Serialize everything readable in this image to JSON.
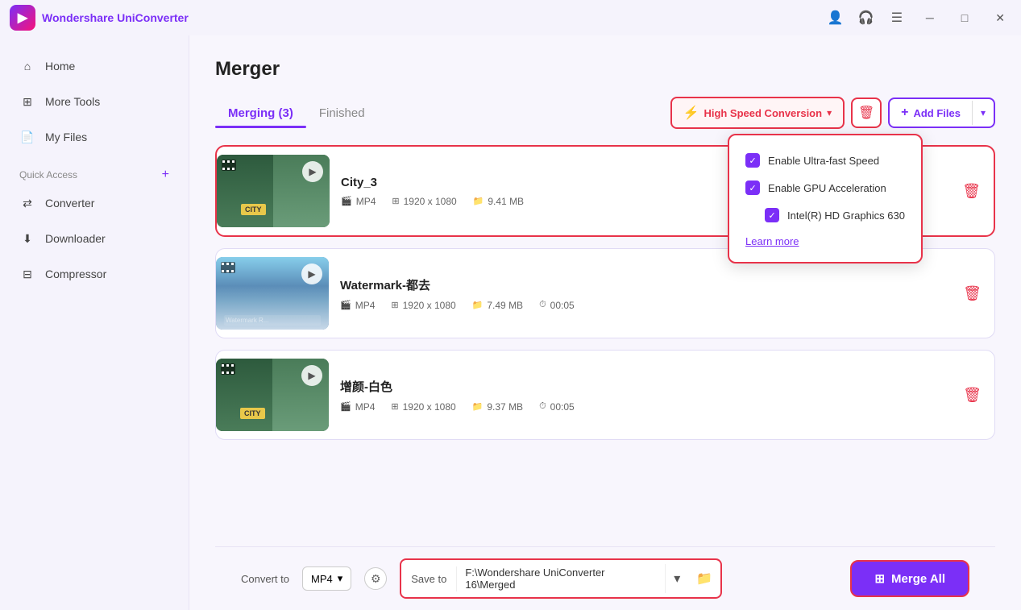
{
  "app": {
    "name_prefix": "Wondershare",
    "name_suffix": "UniConverter",
    "logo_symbol": "▶"
  },
  "titlebar": {
    "icons": {
      "user": "👤",
      "headset": "🎧",
      "menu": "☰",
      "minimize": "─",
      "maximize": "□",
      "close": "✕"
    }
  },
  "sidebar": {
    "items": [
      {
        "id": "home",
        "label": "Home",
        "icon": "⌂",
        "active": false
      },
      {
        "id": "more-tools",
        "label": "More Tools",
        "icon": "⊞",
        "active": false
      },
      {
        "id": "my-files",
        "label": "My Files",
        "icon": "📄",
        "active": false
      }
    ],
    "quick_access_label": "Quick Access",
    "quick_access_plus": "+",
    "nav_items": [
      {
        "id": "converter",
        "label": "Converter",
        "icon": "⇄",
        "active": false
      },
      {
        "id": "downloader",
        "label": "Downloader",
        "icon": "⬇",
        "active": false
      },
      {
        "id": "compressor",
        "label": "Compressor",
        "icon": "⊟",
        "active": false
      }
    ]
  },
  "page": {
    "title": "Merger",
    "tabs": [
      {
        "id": "merging",
        "label": "Merging (3)",
        "active": true
      },
      {
        "id": "finished",
        "label": "Finished",
        "active": false
      }
    ]
  },
  "toolbar": {
    "hsc_label": "High Speed Conversion",
    "hsc_icon": "⚡",
    "delete_icon": "🗑",
    "add_files_label": "Add Files",
    "add_files_plus": "+",
    "dropdown_arrow": "▾"
  },
  "dropdown": {
    "item1_label": "Enable Ultra-fast Speed",
    "item2_label": "Enable GPU Acceleration",
    "item3_label": "Intel(R) HD Graphics 630",
    "learn_more": "Learn more"
  },
  "files": [
    {
      "name": "City_3",
      "format": "MP4",
      "resolution": "1920 x 1080",
      "size": "9.41 MB",
      "duration": "",
      "thumb_class": "thumb-city"
    },
    {
      "name": "Watermark-都去",
      "format": "MP4",
      "resolution": "1920 x 1080",
      "size": "7.49 MB",
      "duration": "00:05",
      "thumb_class": "thumb-watermark"
    },
    {
      "name": "增颜-白色",
      "format": "MP4",
      "resolution": "1920 x 1080",
      "size": "9.37 MB",
      "duration": "00:05",
      "thumb_class": "thumb-zengyan"
    }
  ],
  "bottom": {
    "convert_to_label": "Convert to",
    "format_value": "MP4",
    "format_arrow": "▾",
    "settings_icon": "⚙",
    "save_to_label": "Save to",
    "save_to_path": "F:\\Wondershare UniConverter 16\\Merged",
    "path_arrow": "▾",
    "folder_icon": "📁",
    "merge_icon": "⊞",
    "merge_label": "Merge All"
  }
}
